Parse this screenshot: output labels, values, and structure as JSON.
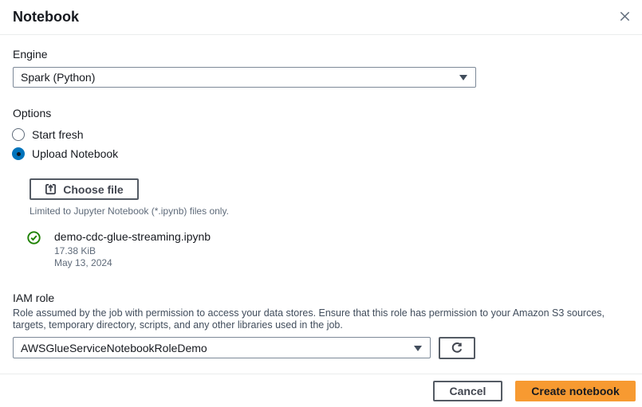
{
  "window": {
    "title": "Notebook"
  },
  "engine": {
    "label": "Engine",
    "selected_value": "Spark (Python)"
  },
  "options": {
    "label": "Options",
    "radios": [
      {
        "label": "Start fresh",
        "selected": false
      },
      {
        "label": "Upload Notebook",
        "selected": true
      }
    ]
  },
  "upload": {
    "choose_file_label": "Choose file",
    "helper": "Limited to Jupyter Notebook (*.ipynb) files only.",
    "file": {
      "name": "demo-cdc-glue-streaming.ipynb",
      "size": "17.38 KiB",
      "date": "May 13, 2024"
    }
  },
  "iam": {
    "label": "IAM role",
    "description": "Role assumed by the job with permission to access your data stores. Ensure that this role has permission to your Amazon S3 sources, targets, temporary directory, scripts, and any other libraries used in the job.",
    "selected_value": "AWSGlueServiceNotebookRoleDemo"
  },
  "footer": {
    "cancel_label": "Cancel",
    "create_label": "Create notebook"
  },
  "icons": {
    "close": "close-icon",
    "upload": "upload-icon",
    "refresh": "refresh-icon",
    "success_check": "check-circle-icon",
    "dropdown_caret": "chevron-down-icon"
  },
  "colors": {
    "primary_orange": "#F79A31",
    "radio_blue": "#0073BB",
    "success_green": "#1D8102",
    "text_dark": "#16191F",
    "text_muted": "#5F6B7A",
    "border_dark": "#545B64",
    "divider": "#EAEDED",
    "input_border": "#7D8998"
  }
}
